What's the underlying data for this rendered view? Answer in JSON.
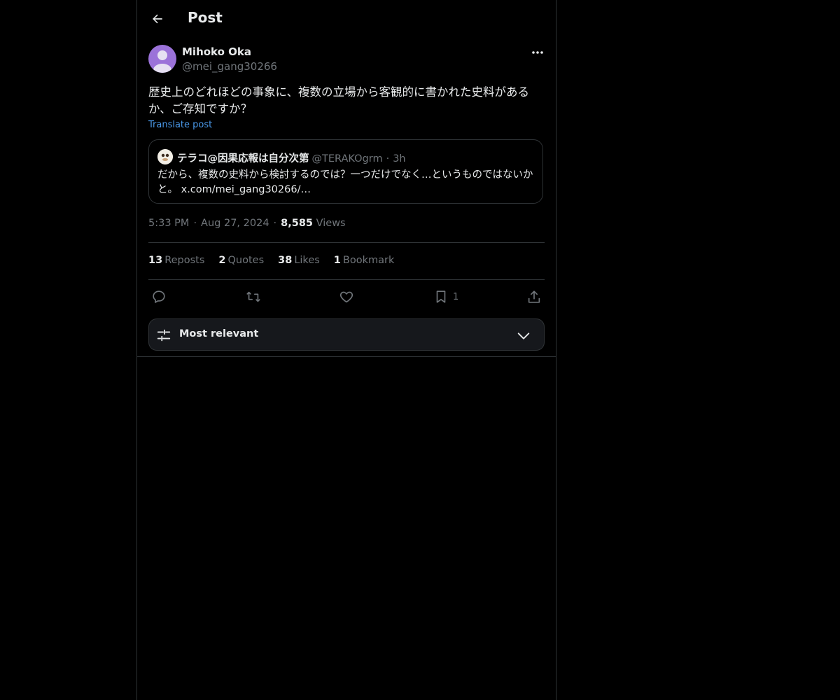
{
  "header": {
    "title": "Post"
  },
  "post": {
    "author": {
      "name": "Mihoko Oka",
      "handle": "@mei_gang30266"
    },
    "text": "歴史上のどれほどの事象に、複数の立場から客観的に書かれた史料があるか、ご存知ですか？",
    "translate_label": "Translate post",
    "quote": {
      "name": "テラコ@因果応報は自分次第",
      "handle": "@TERAKOgrm",
      "separator": "·",
      "time": "3h",
      "text": "だから、複数の史料から検討するのでは？一つだけでなく…というものではないかと。 x.com/mei_gang30266/…"
    },
    "meta": {
      "time": "5:33 PM",
      "separator": "·",
      "date": "Aug 27, 2024",
      "views_count": "8,585",
      "views_label": "Views"
    },
    "stats": {
      "reposts_count": "13",
      "reposts_label": "Reposts",
      "quotes_count": "2",
      "quotes_label": "Quotes",
      "likes_count": "38",
      "likes_label": "Likes",
      "bookmarks_count": "1",
      "bookmarks_label": "Bookmark"
    },
    "actions": {
      "reply_icon": "reply-icon",
      "repost_icon": "repost-icon",
      "like_icon": "heart-icon",
      "bookmark_icon": "bookmark-icon",
      "bookmark_count": "1",
      "share_icon": "share-icon"
    }
  },
  "sort": {
    "label": "Most relevant",
    "icon": "sliders-icon",
    "chevron": "chevron-down-icon"
  },
  "colors": {
    "background": "#000000",
    "text": "#e7e9ea",
    "secondary": "#71767b",
    "link": "#4a99e9",
    "border": "#2f3336",
    "avatar": "#9b72d9"
  }
}
